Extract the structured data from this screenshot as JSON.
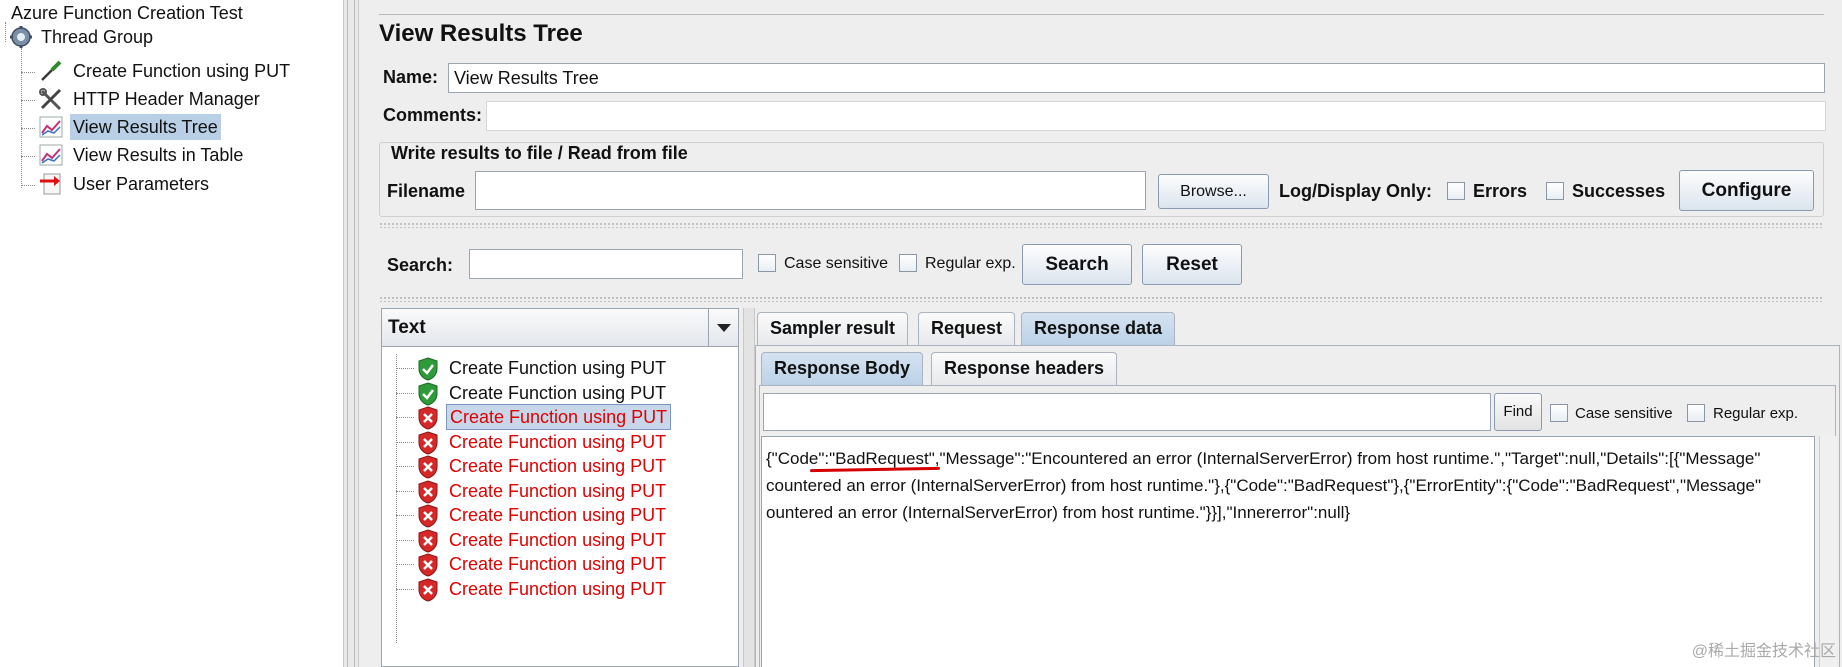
{
  "tree": {
    "root_label": "Azure Function Creation Test",
    "thread_group_label": "Thread Group",
    "children": [
      {
        "label": "Create Function using PUT",
        "icon": "sampler-pipette-icon"
      },
      {
        "label": "HTTP Header Manager",
        "icon": "wrench-screwdriver-icon"
      },
      {
        "label": "View Results Tree",
        "icon": "chart-listener-icon",
        "selected": true
      },
      {
        "label": "View Results in Table",
        "icon": "chart-listener-icon"
      },
      {
        "label": "User Parameters",
        "icon": "preprocessor-arrow-icon"
      }
    ]
  },
  "panel": {
    "title": "View Results Tree",
    "name_label": "Name:",
    "name_value": "View Results Tree",
    "comments_label": "Comments:",
    "comments_value": "",
    "write_section_title": "Write results to file / Read from file",
    "filename_label": "Filename",
    "filename_value": "",
    "browse_label": "Browse...",
    "log_display_label": "Log/Display Only:",
    "errors_label": "Errors",
    "successes_label": "Successes",
    "configure_label": "Configure"
  },
  "search": {
    "label": "Search:",
    "value": "",
    "case_sensitive_label": "Case sensitive",
    "regex_label": "Regular exp.",
    "search_button": "Search",
    "reset_button": "Reset"
  },
  "results": {
    "renderer": "Text",
    "items": [
      {
        "label": "Create Function using PUT",
        "status": "ok"
      },
      {
        "label": "Create Function using PUT",
        "status": "ok"
      },
      {
        "label": "Create Function using PUT",
        "status": "error",
        "selected": true
      },
      {
        "label": "Create Function using PUT",
        "status": "error"
      },
      {
        "label": "Create Function using PUT",
        "status": "error"
      },
      {
        "label": "Create Function using PUT",
        "status": "error"
      },
      {
        "label": "Create Function using PUT",
        "status": "error"
      },
      {
        "label": "Create Function using PUT",
        "status": "error"
      },
      {
        "label": "Create Function using PUT",
        "status": "error"
      },
      {
        "label": "Create Function using PUT",
        "status": "error"
      }
    ]
  },
  "detail": {
    "tabs": [
      "Sampler result",
      "Request",
      "Response data"
    ],
    "active_tab": "Response data",
    "sub_tabs": [
      "Response Body",
      "Response headers"
    ],
    "active_sub_tab": "Response Body",
    "find_value": "",
    "find_button": "Find",
    "case_sensitive_label": "Case sensitive",
    "regex_label": "Regular exp.",
    "response_lines": [
      "{\"Code\":\"BadRequest\",\"Message\":\"Encountered an error (InternalServerError) from host runtime.\",\"Target\":null,\"Details\":[{\"Message\"",
      "countered an error (InternalServerError) from host runtime.\"},{\"Code\":\"BadRequest\"},{\"ErrorEntity\":{\"Code\":\"BadRequest\",\"Message\"",
      "ountered an error (InternalServerError) from host runtime.\"}}],\"Innererror\":null}"
    ]
  },
  "watermark": "@稀土掘金技术社区",
  "colors": {
    "error_text": "#e00000",
    "selection": "#b8cfe5",
    "active_tab": "#c5d8ec",
    "annotation_underline": "#d40000"
  }
}
